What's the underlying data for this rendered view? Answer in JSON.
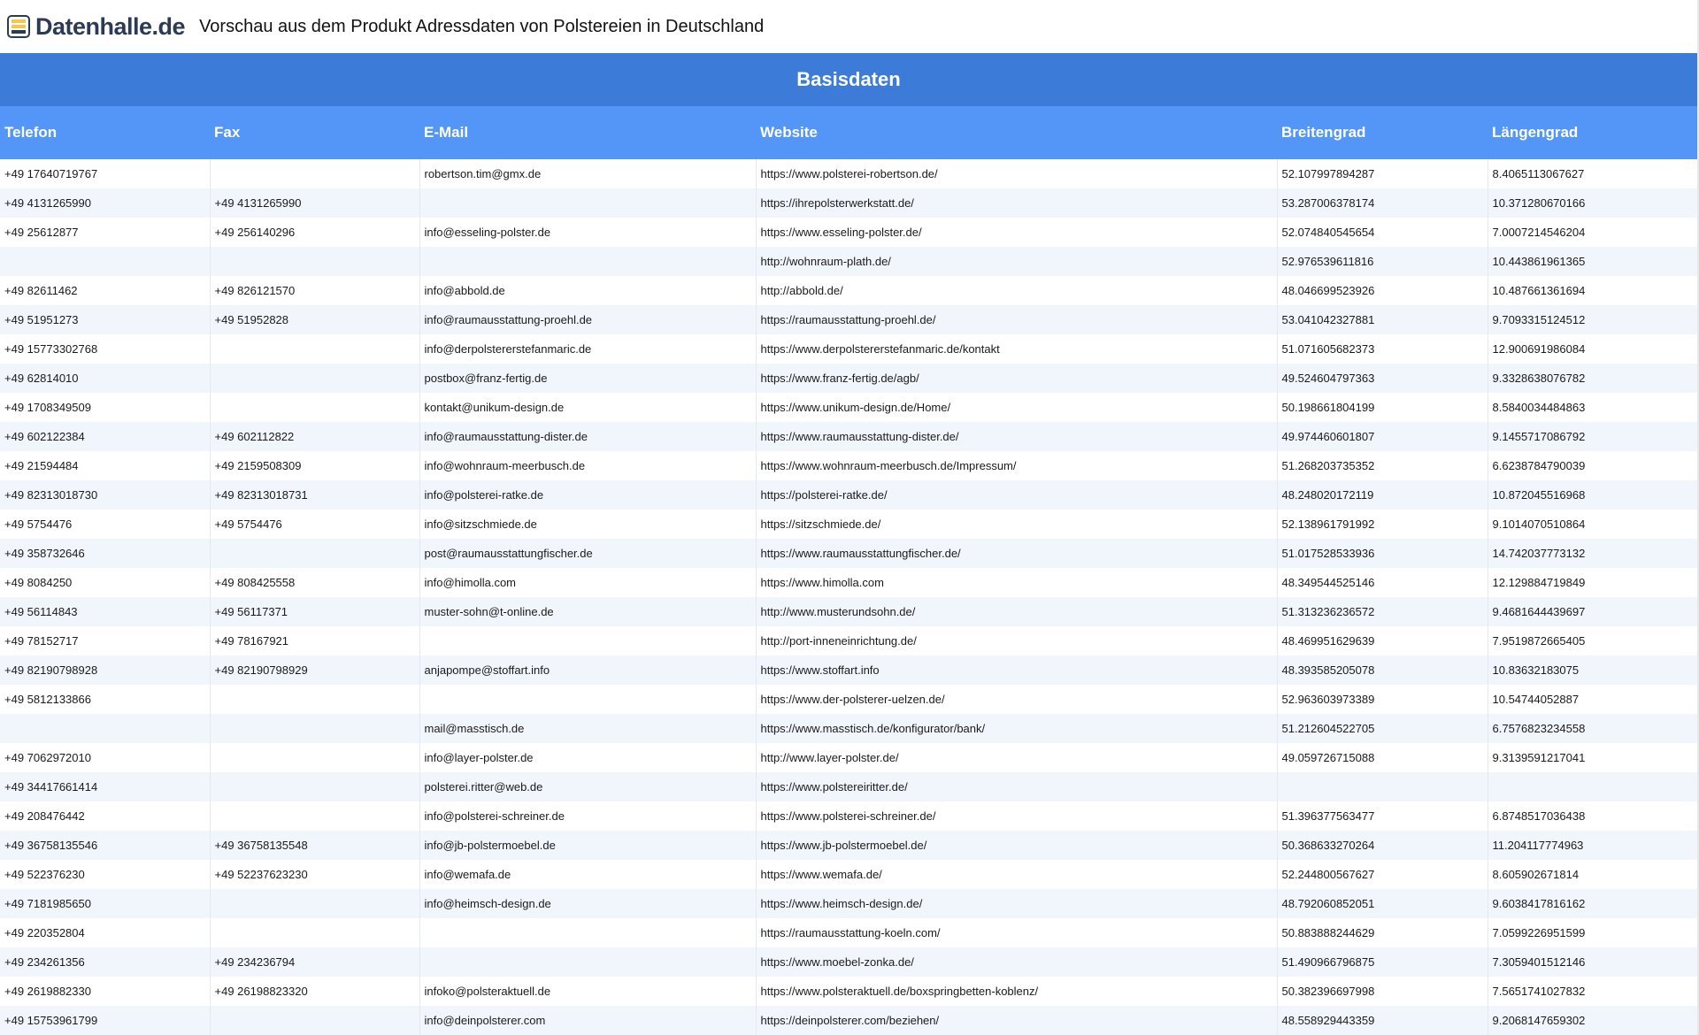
{
  "brand": {
    "name": "Datenhalle.de",
    "accent": "#3d7bd9",
    "header_color": "#5496f7",
    "logo_icon": "database-stack-icon"
  },
  "page_title": "Vorschau aus dem Produkt Adressdaten von Polstereien in Deutschland",
  "section_title": "Basisdaten",
  "columns": [
    "Telefon",
    "Fax",
    "E-Mail",
    "Website",
    "Breitengrad",
    "Längengrad"
  ],
  "rows": [
    [
      "+49 17640719767",
      "",
      "robertson.tim@gmx.de",
      "https://www.polsterei-robertson.de/",
      "52.107997894287",
      "8.4065113067627"
    ],
    [
      "+49 4131265990",
      "+49 4131265990",
      "",
      "https://ihrepolsterwerkstatt.de/",
      "53.287006378174",
      "10.371280670166"
    ],
    [
      "+49 25612877",
      "+49 256140296",
      "info@esseling-polster.de",
      "https://www.esseling-polster.de/",
      "52.074840545654",
      "7.0007214546204"
    ],
    [
      "",
      "",
      "",
      "http://wohnraum-plath.de/",
      "52.976539611816",
      "10.443861961365"
    ],
    [
      "+49 82611462",
      "+49 826121570",
      "info@abbold.de",
      "http://abbold.de/",
      "48.046699523926",
      "10.487661361694"
    ],
    [
      "+49 51951273",
      "+49 51952828",
      "info@raumausstattung-proehl.de",
      "https://raumausstattung-proehl.de/",
      "53.041042327881",
      "9.7093315124512"
    ],
    [
      "+49 15773302768",
      "",
      "info@derpolstererstefanmaric.de",
      "https://www.derpolstererstefanmaric.de/kontakt",
      "51.071605682373",
      "12.900691986084"
    ],
    [
      "+49 62814010",
      "",
      "postbox@franz-fertig.de",
      "https://www.franz-fertig.de/agb/",
      "49.524604797363",
      "9.3328638076782"
    ],
    [
      "+49 1708349509",
      "",
      "kontakt@unikum-design.de",
      "https://www.unikum-design.de/Home/",
      "50.198661804199",
      "8.5840034484863"
    ],
    [
      "+49 602122384",
      "+49 602112822",
      "info@raumausstattung-dister.de",
      "https://www.raumausstattung-dister.de/",
      "49.974460601807",
      "9.1455717086792"
    ],
    [
      "+49 21594484",
      "+49 2159508309",
      "info@wohnraum-meerbusch.de",
      "https://www.wohnraum-meerbusch.de/Impressum/",
      "51.268203735352",
      "6.6238784790039"
    ],
    [
      "+49 82313018730",
      "+49 82313018731",
      "info@polsterei-ratke.de",
      "https://polsterei-ratke.de/",
      "48.248020172119",
      "10.872045516968"
    ],
    [
      "+49 5754476",
      "+49 5754476",
      "info@sitzschmiede.de",
      "https://sitzschmiede.de/",
      "52.138961791992",
      "9.1014070510864"
    ],
    [
      "+49 358732646",
      "",
      "post@raumausstattungfischer.de",
      "https://www.raumausstattungfischer.de/",
      "51.017528533936",
      "14.742037773132"
    ],
    [
      "+49 8084250",
      "+49 808425558",
      "info@himolla.com",
      "https://www.himolla.com",
      "48.349544525146",
      "12.129884719849"
    ],
    [
      "+49 56114843",
      "+49 56117371",
      "muster-sohn@t-online.de",
      "http://www.musterundsohn.de/",
      "51.313236236572",
      "9.4681644439697"
    ],
    [
      "+49 78152717",
      "+49 78167921",
      "",
      "http://port-inneneinrichtung.de/",
      "48.469951629639",
      "7.9519872665405"
    ],
    [
      "+49 82190798928",
      "+49 82190798929",
      "anjapompe@stoffart.info",
      "https://www.stoffart.info",
      "48.393585205078",
      "10.83632183075"
    ],
    [
      "+49 5812133866",
      "",
      "",
      "https://www.der-polsterer-uelzen.de/",
      "52.963603973389",
      "10.54744052887"
    ],
    [
      "",
      "",
      "mail@masstisch.de",
      "https://www.masstisch.de/konfigurator/bank/",
      "51.212604522705",
      "6.7576823234558"
    ],
    [
      "+49 7062972010",
      "",
      "info@layer-polster.de",
      "http://www.layer-polster.de/",
      "49.059726715088",
      "9.3139591217041"
    ],
    [
      "+49 34417661414",
      "",
      "polsterei.ritter@web.de",
      "https://www.polstereiritter.de/",
      "",
      ""
    ],
    [
      "+49 208476442",
      "",
      "info@polsterei-schreiner.de",
      "https://www.polsterei-schreiner.de/",
      "51.396377563477",
      "6.8748517036438"
    ],
    [
      "+49 36758135546",
      "+49 36758135548",
      "info@jb-polstermoebel.de",
      "https://www.jb-polstermoebel.de/",
      "50.368633270264",
      "11.204117774963"
    ],
    [
      "+49 522376230",
      "+49 52237623230",
      "info@wemafa.de",
      "https://www.wemafa.de/",
      "52.244800567627",
      "8.605902671814"
    ],
    [
      "+49 7181985650",
      "",
      "info@heimsch-design.de",
      "https://www.heimsch-design.de/",
      "48.792060852051",
      "9.6038417816162"
    ],
    [
      "+49 220352804",
      "",
      "",
      "https://raumausstattung-koeln.com/",
      "50.883888244629",
      "7.0599226951599"
    ],
    [
      "+49 234261356",
      "+49 234236794",
      "",
      "https://www.moebel-zonka.de/",
      "51.490966796875",
      "7.3059401512146"
    ],
    [
      "+49 2619882330",
      "+49 26198823320",
      "infoko@polsteraktuell.de",
      "https://www.polsteraktuell.de/boxspringbetten-koblenz/",
      "50.382396697998",
      "7.5651741027832"
    ],
    [
      "+49 15753961799",
      "",
      "info@deinpolsterer.com",
      "https://deinpolsterer.com/beziehen/",
      "48.558929443359",
      "9.2068147659302"
    ]
  ]
}
